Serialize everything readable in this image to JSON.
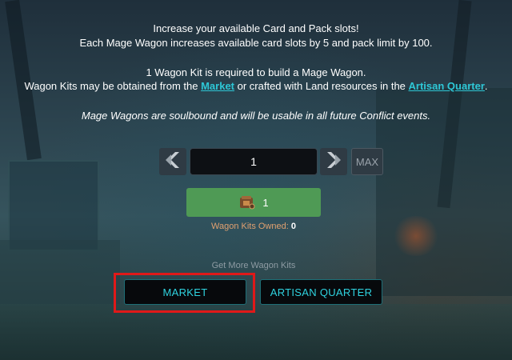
{
  "info": {
    "line1": "Increase your available Card and Pack slots!",
    "line2": "Each Mage Wagon increases available card slots by 5 and pack limit by 100.",
    "line3": "1 Wagon Kit is required to build a Mage Wagon.",
    "line4_prefix": "Wagon Kits may be obtained from the ",
    "line4_market_link": "Market",
    "line4_middle": " or crafted with Land resources in the ",
    "line4_artisan_link": "Artisan Quarter",
    "line4_suffix": ".",
    "line5": "Mage Wagons are soulbound and will be usable in all future Conflict events."
  },
  "quantity": {
    "value": "1",
    "max_label": "MAX",
    "prev_icon": "chevron-left-icon",
    "next_icon": "chevron-right-icon"
  },
  "cost": {
    "icon": "wagon-kit-icon",
    "value": "1"
  },
  "owned": {
    "label": "Wagon Kits Owned: ",
    "count": "0"
  },
  "get_more": {
    "label": "Get More Wagon Kits",
    "market_button": "MARKET",
    "artisan_button": "ARTISAN QUARTER"
  },
  "colors": {
    "accent_cyan": "#2fd3e0",
    "cost_green": "#4f9a55",
    "highlight_red": "#e01919"
  }
}
